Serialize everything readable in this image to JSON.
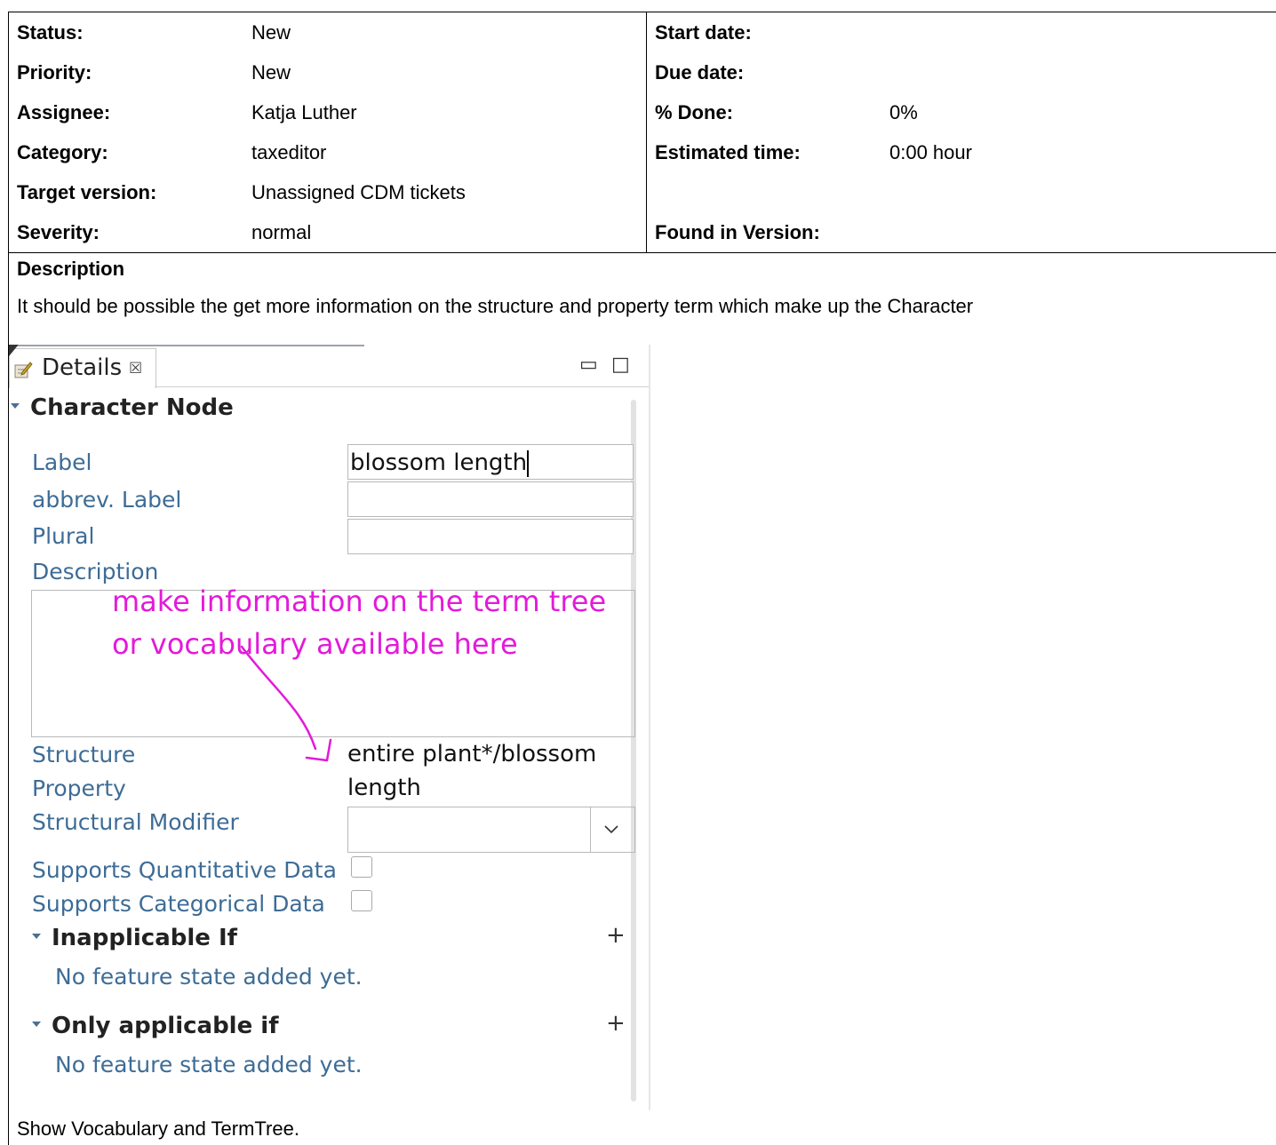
{
  "attributes": {
    "left": [
      {
        "label": "Status:",
        "value": "New"
      },
      {
        "label": "Priority:",
        "value": "New"
      },
      {
        "label": "Assignee:",
        "value": "Katja Luther"
      },
      {
        "label": "Category:",
        "value": "taxeditor"
      },
      {
        "label": "Target version:",
        "value": "Unassigned CDM tickets"
      },
      {
        "label": "Severity:",
        "value": "normal"
      }
    ],
    "right": [
      {
        "label": "Start date:",
        "value": ""
      },
      {
        "label": "Due date:",
        "value": ""
      },
      {
        "label": "% Done:",
        "value": "0%"
      },
      {
        "label": "Estimated time:",
        "value": "0:00 hour"
      },
      {
        "label": "",
        "value": ""
      },
      {
        "label": "Found in Version:",
        "value": ""
      }
    ]
  },
  "description": {
    "heading": "Description",
    "text": "It should be possible the get more information on the structure and property term which make up the Character",
    "footer": "Show Vocabulary and TermTree."
  },
  "screenshot": {
    "tab": {
      "label": "Details",
      "close_glyph": "☒"
    },
    "view_buttons": {
      "minimize": "▭",
      "maximize": "□"
    },
    "section_title": "Character Node",
    "fields": {
      "label": {
        "name": "Label",
        "value": "blossom length"
      },
      "abbrev_label": {
        "name": "abbrev. Label",
        "value": ""
      },
      "plural": {
        "name": "Plural",
        "value": ""
      },
      "description": {
        "name": "Description"
      },
      "structure": {
        "name": "Structure",
        "value": "entire plant*/blossom"
      },
      "property": {
        "name": "Property",
        "value": "length"
      },
      "structural_modifier": {
        "name": "Structural Modifier",
        "value": ""
      },
      "supports_quantitative": {
        "name": "Supports Quantitative Data",
        "checked": false
      },
      "supports_categorical": {
        "name": "Supports Categorical Data",
        "checked": false
      }
    },
    "inapplicable": {
      "title": "Inapplicable If",
      "plus": "+",
      "empty": "No feature state added yet."
    },
    "only_applicable": {
      "title": "Only applicable if",
      "plus": "+",
      "empty": "No feature state added yet."
    },
    "annotation": {
      "line1": "make information on the term tree",
      "line2": "or vocabulary available here",
      "color": "#e31ad9"
    }
  }
}
